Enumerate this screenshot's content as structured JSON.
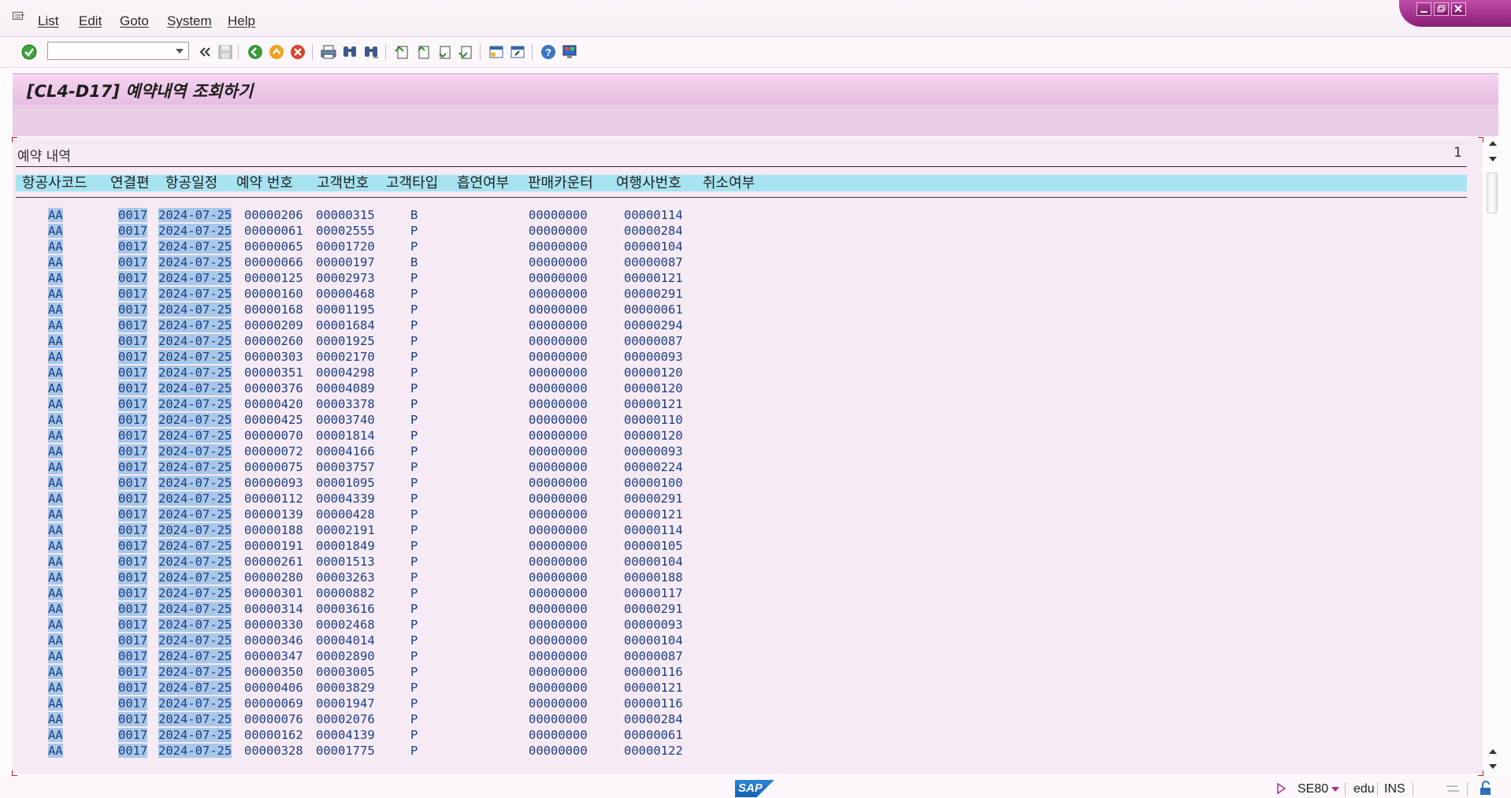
{
  "menu": [
    "List",
    "Edit",
    "Goto",
    "System",
    "Help"
  ],
  "title": "[CL4-D17] 예약내역 조회하기",
  "list": {
    "header": "예약 내역",
    "page": "1",
    "columns": [
      "항공사코드",
      "연결편",
      "항공일정",
      "예약 번호",
      "고객번호",
      "고객타입",
      "흡연여부",
      "판매카운터",
      "여행사번호",
      "취소여부"
    ],
    "rows": [
      [
        "AA",
        "0017",
        "2024-07-25",
        "00000206",
        "00000315",
        "B",
        "00000000",
        "00000114"
      ],
      [
        "AA",
        "0017",
        "2024-07-25",
        "00000061",
        "00002555",
        "P",
        "00000000",
        "00000284"
      ],
      [
        "AA",
        "0017",
        "2024-07-25",
        "00000065",
        "00001720",
        "P",
        "00000000",
        "00000104"
      ],
      [
        "AA",
        "0017",
        "2024-07-25",
        "00000066",
        "00000197",
        "B",
        "00000000",
        "00000087"
      ],
      [
        "AA",
        "0017",
        "2024-07-25",
        "00000125",
        "00002973",
        "P",
        "00000000",
        "00000121"
      ],
      [
        "AA",
        "0017",
        "2024-07-25",
        "00000160",
        "00000468",
        "P",
        "00000000",
        "00000291"
      ],
      [
        "AA",
        "0017",
        "2024-07-25",
        "00000168",
        "00001195",
        "P",
        "00000000",
        "00000061"
      ],
      [
        "AA",
        "0017",
        "2024-07-25",
        "00000209",
        "00001684",
        "P",
        "00000000",
        "00000294"
      ],
      [
        "AA",
        "0017",
        "2024-07-25",
        "00000260",
        "00001925",
        "P",
        "00000000",
        "00000087"
      ],
      [
        "AA",
        "0017",
        "2024-07-25",
        "00000303",
        "00002170",
        "P",
        "00000000",
        "00000093"
      ],
      [
        "AA",
        "0017",
        "2024-07-25",
        "00000351",
        "00004298",
        "P",
        "00000000",
        "00000120"
      ],
      [
        "AA",
        "0017",
        "2024-07-25",
        "00000376",
        "00004089",
        "P",
        "00000000",
        "00000120"
      ],
      [
        "AA",
        "0017",
        "2024-07-25",
        "00000420",
        "00003378",
        "P",
        "00000000",
        "00000121"
      ],
      [
        "AA",
        "0017",
        "2024-07-25",
        "00000425",
        "00003740",
        "P",
        "00000000",
        "00000110"
      ],
      [
        "AA",
        "0017",
        "2024-07-25",
        "00000070",
        "00001814",
        "P",
        "00000000",
        "00000120"
      ],
      [
        "AA",
        "0017",
        "2024-07-25",
        "00000072",
        "00004166",
        "P",
        "00000000",
        "00000093"
      ],
      [
        "AA",
        "0017",
        "2024-07-25",
        "00000075",
        "00003757",
        "P",
        "00000000",
        "00000224"
      ],
      [
        "AA",
        "0017",
        "2024-07-25",
        "00000093",
        "00001095",
        "P",
        "00000000",
        "00000100"
      ],
      [
        "AA",
        "0017",
        "2024-07-25",
        "00000112",
        "00004339",
        "P",
        "00000000",
        "00000291"
      ],
      [
        "AA",
        "0017",
        "2024-07-25",
        "00000139",
        "00000428",
        "P",
        "00000000",
        "00000121"
      ],
      [
        "AA",
        "0017",
        "2024-07-25",
        "00000188",
        "00002191",
        "P",
        "00000000",
        "00000114"
      ],
      [
        "AA",
        "0017",
        "2024-07-25",
        "00000191",
        "00001849",
        "P",
        "00000000",
        "00000105"
      ],
      [
        "AA",
        "0017",
        "2024-07-25",
        "00000261",
        "00001513",
        "P",
        "00000000",
        "00000104"
      ],
      [
        "AA",
        "0017",
        "2024-07-25",
        "00000280",
        "00003263",
        "P",
        "00000000",
        "00000188"
      ],
      [
        "AA",
        "0017",
        "2024-07-25",
        "00000301",
        "00000882",
        "P",
        "00000000",
        "00000117"
      ],
      [
        "AA",
        "0017",
        "2024-07-25",
        "00000314",
        "00003616",
        "P",
        "00000000",
        "00000291"
      ],
      [
        "AA",
        "0017",
        "2024-07-25",
        "00000330",
        "00002468",
        "P",
        "00000000",
        "00000093"
      ],
      [
        "AA",
        "0017",
        "2024-07-25",
        "00000346",
        "00004014",
        "P",
        "00000000",
        "00000104"
      ],
      [
        "AA",
        "0017",
        "2024-07-25",
        "00000347",
        "00002890",
        "P",
        "00000000",
        "00000087"
      ],
      [
        "AA",
        "0017",
        "2024-07-25",
        "00000350",
        "00003005",
        "P",
        "00000000",
        "00000116"
      ],
      [
        "AA",
        "0017",
        "2024-07-25",
        "00000406",
        "00003829",
        "P",
        "00000000",
        "00000121"
      ],
      [
        "AA",
        "0017",
        "2024-07-25",
        "00000069",
        "00001947",
        "P",
        "00000000",
        "00000116"
      ],
      [
        "AA",
        "0017",
        "2024-07-25",
        "00000076",
        "00002076",
        "P",
        "00000000",
        "00000284"
      ],
      [
        "AA",
        "0017",
        "2024-07-25",
        "00000162",
        "00004139",
        "P",
        "00000000",
        "00000061"
      ],
      [
        "AA",
        "0017",
        "2024-07-25",
        "00000328",
        "00001775",
        "P",
        "00000000",
        "00000122"
      ]
    ]
  },
  "status": {
    "logo": "SAP",
    "transaction": "SE80",
    "system": "edu",
    "mode": "INS"
  },
  "colors": {
    "header_bg": "#a7e3f1",
    "key_highlight": "#a9c7e8",
    "row_text": "#1a3f86",
    "title_bg": "#e8bce2"
  }
}
